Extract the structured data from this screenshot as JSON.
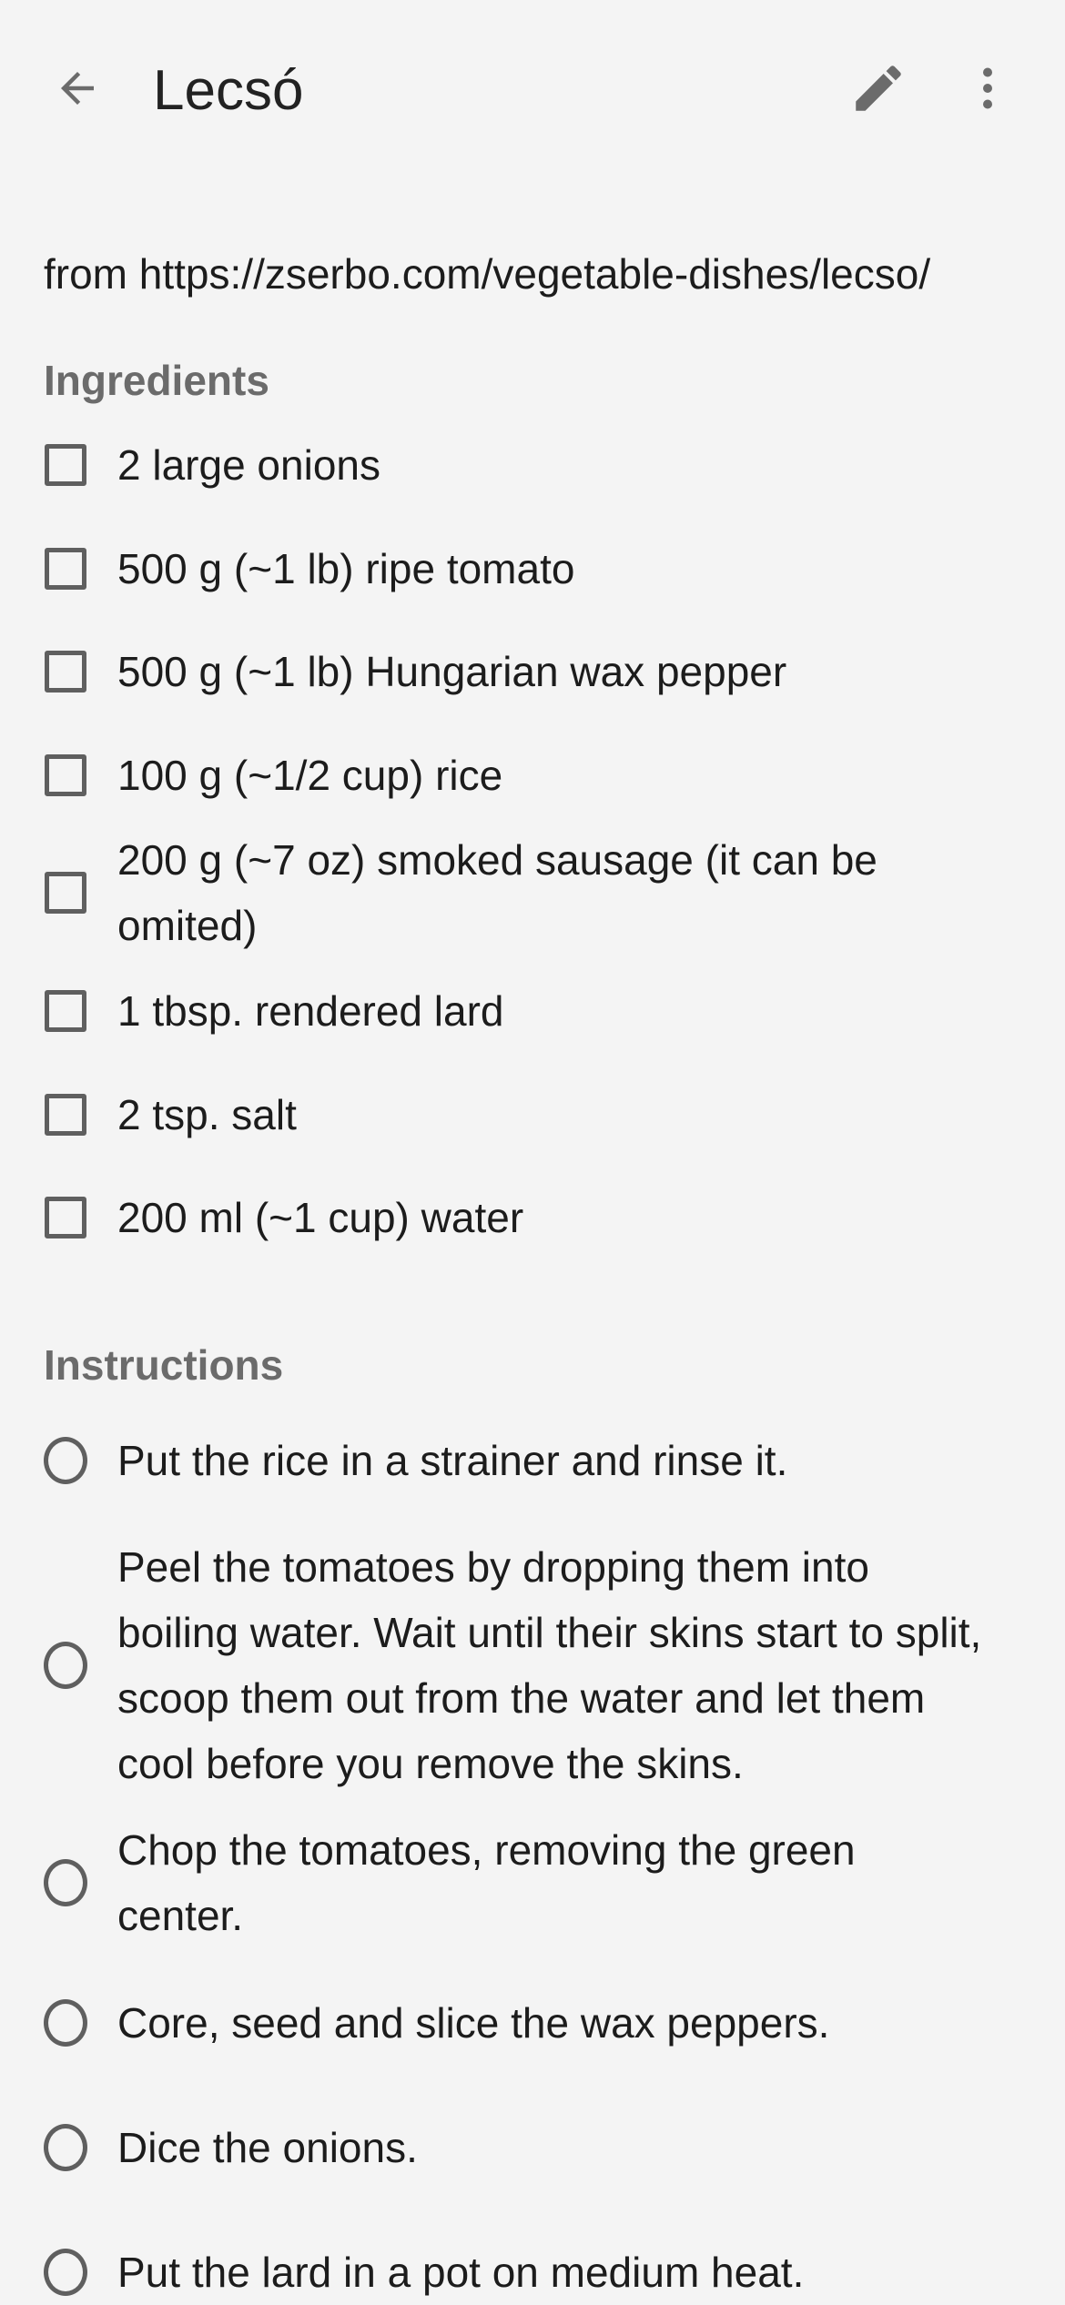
{
  "app_bar": {
    "title": "Lecsó",
    "back_icon": "arrow-back-icon",
    "edit_icon": "pencil-icon",
    "more_icon": "more-vert-icon",
    "icon_color": "#6b6b6b"
  },
  "source": "from https://zserbo.com/vegetable-dishes/lecso/",
  "ingredients": {
    "heading": "Ingredients",
    "items": [
      {
        "label": "2 large onions",
        "checked": false
      },
      {
        "label": "500 g (~1 lb) ripe tomato",
        "checked": false
      },
      {
        "label": "500 g (~1 lb) Hungarian wax pepper",
        "checked": false
      },
      {
        "label": "100 g (~1/2 cup) rice",
        "checked": false
      },
      {
        "label": "200 g (~7 oz) smoked sausage (it can be omited)",
        "checked": false
      },
      {
        "label": "1 tbsp. rendered lard",
        "checked": false
      },
      {
        "label": "2 tsp. salt",
        "checked": false
      },
      {
        "label": "200 ml (~1 cup) water",
        "checked": false
      }
    ]
  },
  "instructions": {
    "heading": "Instructions",
    "steps": [
      {
        "label": "Put the rice in a strainer and rinse it.",
        "done": false
      },
      {
        "label": "Peel the tomatoes by dropping them into boiling water. Wait until their skins start to split, scoop them out from the water and let them cool before you remove the skins.",
        "done": false
      },
      {
        "label": "Chop the tomatoes, removing the green center.",
        "done": false
      },
      {
        "label": "Core, seed and slice the wax peppers.",
        "done": false
      },
      {
        "label": "Dice the onions.",
        "done": false
      },
      {
        "label": "Put the lard in a pot on medium heat.",
        "done": false
      }
    ]
  }
}
